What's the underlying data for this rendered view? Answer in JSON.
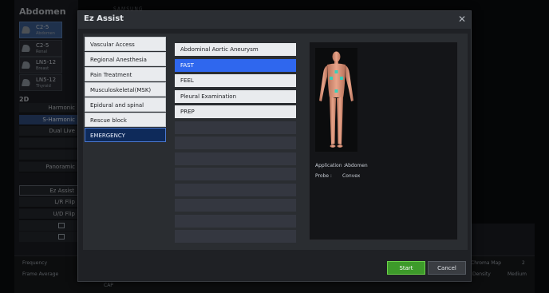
{
  "background": {
    "title": "Abdomen",
    "brand": "SAMSUNG",
    "probes": [
      {
        "name": "C2-5",
        "sub": "Abdomen"
      },
      {
        "name": "C2-5",
        "sub": "Renal"
      },
      {
        "name": "LN5-12",
        "sub": "Breast"
      },
      {
        "name": "LN5-12",
        "sub": "Thyroid"
      }
    ],
    "mode_label": "2D",
    "buttons": [
      "Harmonic",
      "S-Harmonic",
      "Dual Live",
      "Panoramic",
      "Ez Assist",
      "L/R Flip",
      "U/D Flip"
    ],
    "bottom_labels": {
      "frequency": "Frequency",
      "frame_average": "Frame Average",
      "cap": "CAP",
      "chroma_map": "Chroma Map",
      "chroma_value": "2",
      "density": "Density",
      "density_value": "Medium"
    }
  },
  "dialog": {
    "title": "Ez Assist",
    "close_icon": "close-icon",
    "categories": [
      {
        "label": "Vascular Access",
        "selected": false
      },
      {
        "label": "Regional Anesthesia",
        "selected": false
      },
      {
        "label": "Pain Treatment",
        "selected": false
      },
      {
        "label": "Musculoskeletal(MSK)",
        "selected": false
      },
      {
        "label": "Epidural and spinal",
        "selected": false
      },
      {
        "label": "Rescue block",
        "selected": false
      },
      {
        "label": "EMERGENCY",
        "selected": true
      }
    ],
    "presets": [
      {
        "label": "Abdominal Aortic Aneurysm",
        "selected": false
      },
      {
        "label": "FAST",
        "selected": true
      },
      {
        "label": "FEEL",
        "selected": false
      },
      {
        "label": "Pleural Examination",
        "selected": false
      },
      {
        "label": "PREP",
        "selected": false
      }
    ],
    "preview": {
      "application_label": "Application :",
      "application_value": "Abdomen",
      "probe_label": "Probe :",
      "probe_value": "Convex"
    },
    "start_label": "Start",
    "cancel_label": "Cancel"
  },
  "colors": {
    "selected_category": "#0e2a5a",
    "selected_preset": "#2f67ee",
    "start_button": "#3d9a2a"
  }
}
